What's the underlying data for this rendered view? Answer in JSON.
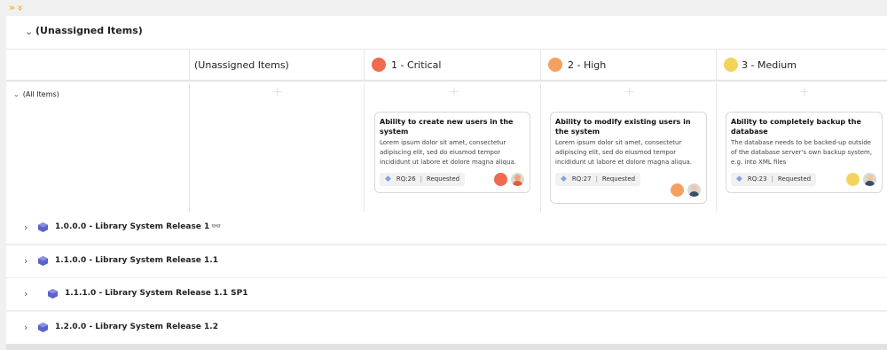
{
  "top_toggles": {
    "expand_right": "»",
    "expand_down": "»"
  },
  "group": {
    "title": "(Unassigned Items)"
  },
  "columns": {
    "unassigned": "(Unassigned Items)",
    "critical": {
      "label": "1 - Critical",
      "color": "#f06a50"
    },
    "high": {
      "label": "2 - High",
      "color": "#f4a060"
    },
    "medium": {
      "label": "3 - Medium",
      "color": "#f2d45a"
    }
  },
  "swimlane": {
    "label": "(All Items)",
    "plus": "+"
  },
  "cards": [
    {
      "title": "Ability to create new users in the system",
      "description": "Lorem ipsum dolor sit amet, consectetur adipiscing elit, sed do eiusmod tempor incididunt ut labore et dolore magna aliqua.",
      "id": "RQ:26",
      "sep": "|",
      "status": "Requested",
      "priority_color": "#f06a50"
    },
    {
      "title": "Ability to modify existing users in the system",
      "description": "Lorem ipsum dolor sit amet, consectetur adipiscing elit, sed do eiusmod tempor incididunt ut labore et dolore magna aliqua.",
      "id": "RQ:27",
      "sep": "|",
      "status": "Requested",
      "priority_color": "#f4a060"
    },
    {
      "title": "Ability to completely backup the database",
      "description": "The database needs to be backed-up outside of the database server's own backup system, e.g. into XML files",
      "id": "RQ:23",
      "sep": "|",
      "status": "Requested",
      "priority_color": "#f2d45a"
    }
  ],
  "releases": [
    {
      "title": "1.0.0.0 - Library System Release 1",
      "glasses": "👓"
    },
    {
      "title": "1.1.0.0 - Library System Release 1.1"
    },
    {
      "title": "1.1.1.0 - Library System Release 1.1 SP1"
    },
    {
      "title": "1.2.0.0 - Library System Release 1.2"
    }
  ],
  "colors": {
    "cube": "#5a63c9",
    "toggle": "#f0b43c"
  }
}
